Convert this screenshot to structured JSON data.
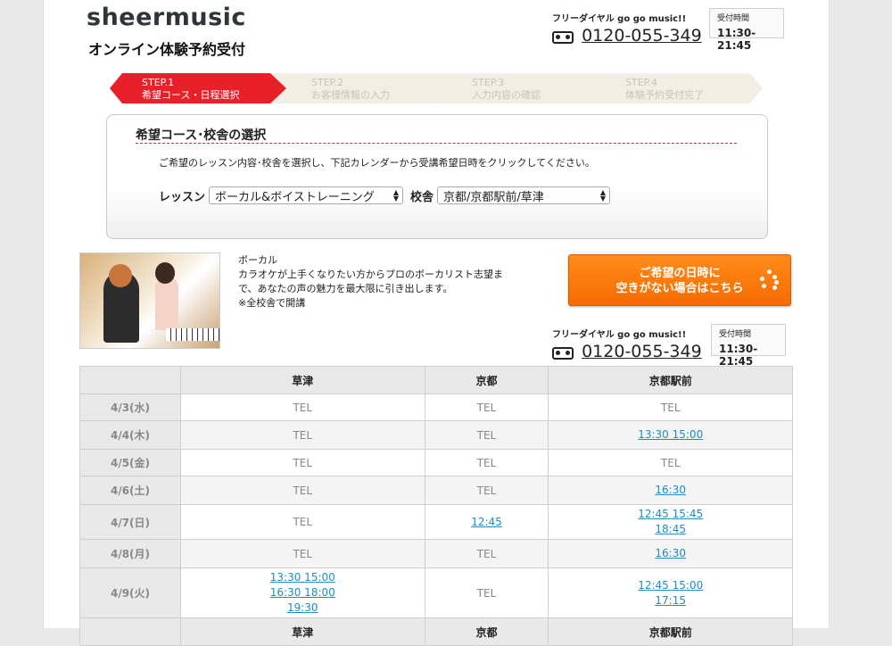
{
  "header": {
    "logo": "sheermusic",
    "subtitle": "オンライン体験予約受付",
    "free_dial_label": "フリーダイヤル  go go music!!",
    "phone": "0120-055-349",
    "hours_label": "受付時間",
    "hours": "11:30-21:45"
  },
  "steps": [
    {
      "num": "STEP.1",
      "label": "希望コース・日程選択",
      "active": true
    },
    {
      "num": "STEP.2",
      "label": "お客様情報の入力",
      "active": false
    },
    {
      "num": "STEP.3",
      "label": "入力内容の確認",
      "active": false
    },
    {
      "num": "STEP.4",
      "label": "体験予約受付完了",
      "active": false
    }
  ],
  "panel": {
    "title": "希望コース･校舎の選択",
    "description": "ご希望のレッスン内容･校舎を選択し、下記カレンダーから受講希望日時をクリックしてください。",
    "lesson_label": "レッスン",
    "lesson_value": "ボーカル&ボイストレーニング",
    "school_label": "校舎",
    "school_value": "京都/京都駅前/草津"
  },
  "course": {
    "name": "ボーカル",
    "line1": "カラオケが上手くなりたい方からプロのボーカリスト志望ま",
    "line2": "で、あなたの声の魅力を最大限に引き出します。",
    "note": "※全校舎で開講"
  },
  "cta": {
    "line1": "ご希望の日時に",
    "line2": "空きがない場合はこちら",
    "color": "#f57c00"
  },
  "table": {
    "headers": [
      "",
      "草津",
      "京都",
      "京都駅前"
    ],
    "rows": [
      {
        "date": "4/3(水)",
        "cells": [
          [
            "TEL"
          ],
          [
            "TEL"
          ],
          [
            "TEL"
          ]
        ]
      },
      {
        "date": "4/4(木)",
        "cells": [
          [
            "TEL"
          ],
          [
            "TEL"
          ],
          [
            "13:30 15:00"
          ]
        ]
      },
      {
        "date": "4/5(金)",
        "cells": [
          [
            "TEL"
          ],
          [
            "TEL"
          ],
          [
            "TEL"
          ]
        ]
      },
      {
        "date": "4/6(土)",
        "cells": [
          [
            "TEL"
          ],
          [
            "TEL"
          ],
          [
            "16:30"
          ]
        ]
      },
      {
        "date": "4/7(日)",
        "cells": [
          [
            "TEL"
          ],
          [
            "12:45"
          ],
          [
            "12:45 15:45",
            "18:45"
          ]
        ]
      },
      {
        "date": "4/8(月)",
        "cells": [
          [
            "TEL"
          ],
          [
            "TEL"
          ],
          [
            "16:30"
          ]
        ]
      },
      {
        "date": "4/9(火)",
        "cells": [
          [
            "13:30 15:00",
            "16:30 18:00",
            "19:30"
          ],
          [
            "TEL"
          ],
          [
            "12:45 15:00",
            "17:15"
          ]
        ]
      }
    ]
  },
  "colors": {
    "accent": "#e8202a",
    "link": "#1a8fc0",
    "orange": "#f57c00"
  }
}
